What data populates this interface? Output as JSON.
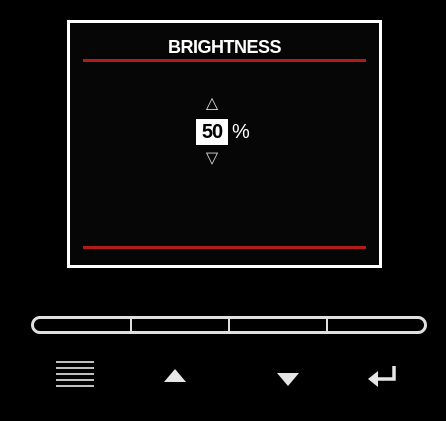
{
  "screen": {
    "title": "BRIGHTNESS",
    "up_glyph": "△",
    "down_glyph": "▽",
    "value": "50",
    "unit": "%"
  },
  "controls": {
    "buttons": [
      {
        "id": "menu",
        "icon": "menu-icon"
      },
      {
        "id": "up",
        "icon": "triangle-up-icon"
      },
      {
        "id": "down",
        "icon": "triangle-down-icon"
      },
      {
        "id": "enter",
        "icon": "enter-return-icon"
      }
    ]
  },
  "colors": {
    "background": "#000000",
    "frame": "#ffffff",
    "accent_rule": "#b31b1b",
    "text": "#ffffff"
  }
}
